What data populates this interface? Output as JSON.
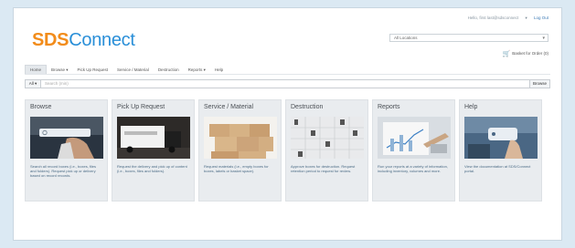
{
  "header": {
    "logo_sds": "SDS",
    "logo_connect": "Connect",
    "user_text": "Hello, first last@sdsconnect",
    "user_caret": "▾",
    "logout": "Log Out",
    "account_select": "All Locations",
    "basket": "Basket for Order (0)"
  },
  "nav": {
    "tabs": [
      {
        "label": "Home"
      },
      {
        "label": "Browse ▾"
      },
      {
        "label": "Pick Up Request"
      },
      {
        "label": "Service / Material"
      },
      {
        "label": "Destruction"
      },
      {
        "label": "Reports ▾"
      },
      {
        "label": "Help"
      }
    ]
  },
  "search": {
    "scope": "All ▾",
    "placeholder": "Search (min)",
    "button": "Browse"
  },
  "tiles": [
    {
      "title": "Browse",
      "desc": "Search all record boxes (i.e., boxes, files and folders). Request pick up or delivery based on record records."
    },
    {
      "title": "Pick Up Request",
      "desc": "Request the delivery and pick up of content (i.e., boxes, files and folders)."
    },
    {
      "title": "Service / Material",
      "desc": "Request materials (i.e., empty boxes for boxes, labels or basket space)."
    },
    {
      "title": "Destruction",
      "desc": "Approve boxes for destruction. Request retention period to request for review."
    },
    {
      "title": "Reports",
      "desc": "Run your reports at a variety of information, including inventory, volumes and more."
    },
    {
      "title": "Help",
      "desc": "View the documentation at SDS/Connect portal."
    }
  ],
  "colors": {
    "logo_orange": "#f28c1b",
    "logo_blue": "#2a8fd8",
    "page_bg": "#dbe9f3"
  }
}
